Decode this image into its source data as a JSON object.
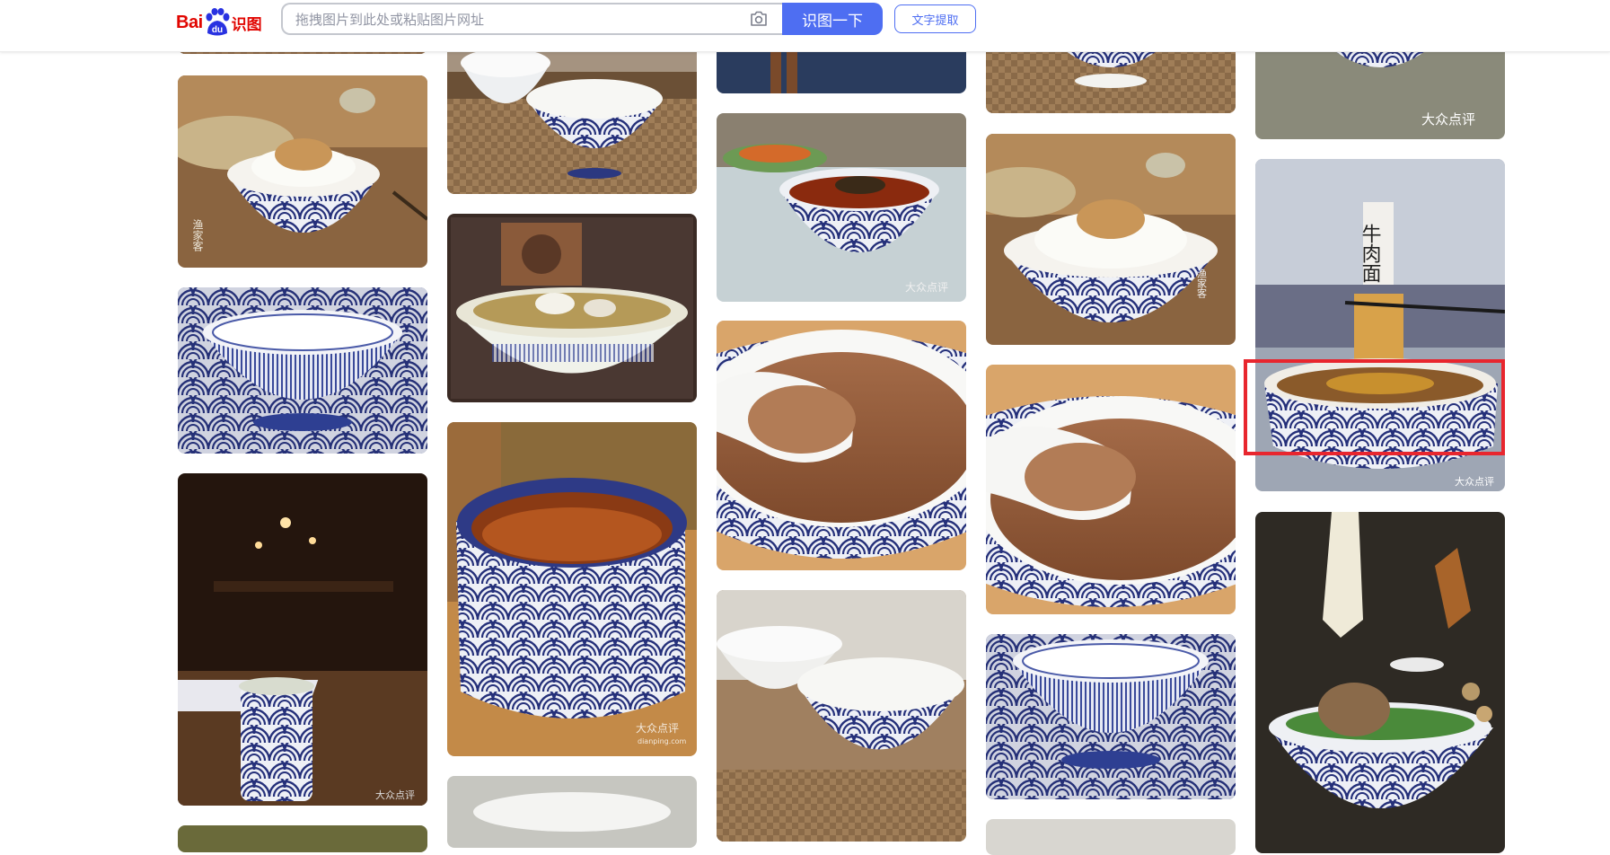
{
  "header": {
    "logo": {
      "brand_prefix": "Bai",
      "brand_mid": "du",
      "brand_suffix": "识图"
    },
    "search": {
      "placeholder": "拖拽图片到此处或粘贴图片网址",
      "camera_icon": "camera-icon"
    },
    "search_button_label": "识图一下",
    "ocr_button_label": "文字提取"
  },
  "colors": {
    "brand_red": "#e10601",
    "accent_blue": "#4e6ef2",
    "highlight_red": "#e8262e"
  },
  "watermarks": {
    "dianping": "大众点评",
    "dianping_url": "dianping.com",
    "yujiake": "渔家客",
    "niuroumian": "牛肉面"
  },
  "highlighted_result_index": 18,
  "results": [
    {
      "id": 1,
      "subject": "top-cropped-bowl"
    },
    {
      "id": 2,
      "subject": "rice-bowl-wave"
    },
    {
      "id": 3,
      "subject": "wave-bowl-on-mat"
    },
    {
      "id": 4,
      "subject": "wave-cup-restaurant"
    },
    {
      "id": 5,
      "subject": "bottom-cropped-dish"
    },
    {
      "id": 6,
      "subject": "empty-wave-bowl"
    },
    {
      "id": 7,
      "subject": "fish-soup-bowl"
    },
    {
      "id": 8,
      "subject": "wave-cup-tea"
    },
    {
      "id": 9,
      "subject": "bottom-cropped-bowl"
    },
    {
      "id": 10,
      "subject": "top-cropped-chopsticks"
    },
    {
      "id": 11,
      "subject": "noodle-soup-bowl"
    },
    {
      "id": 12,
      "subject": "soup-spoon-bowl"
    },
    {
      "id": 13,
      "subject": "empty-wave-bowl"
    },
    {
      "id": 14,
      "subject": "top-cropped-bowl"
    },
    {
      "id": 15,
      "subject": "rice-bowl-wave"
    },
    {
      "id": 16,
      "subject": "soup-spoon-bowl"
    },
    {
      "id": 17,
      "subject": "wave-bowl-on-mat"
    },
    {
      "id": 18,
      "subject": "bottom-cropped-bowl"
    },
    {
      "id": 19,
      "subject": "top-cropped-wave-bowl"
    },
    {
      "id": 20,
      "subject": "beef-noodle-wave-bowl"
    },
    {
      "id": 21,
      "subject": "noodle-bowl-dark"
    }
  ]
}
